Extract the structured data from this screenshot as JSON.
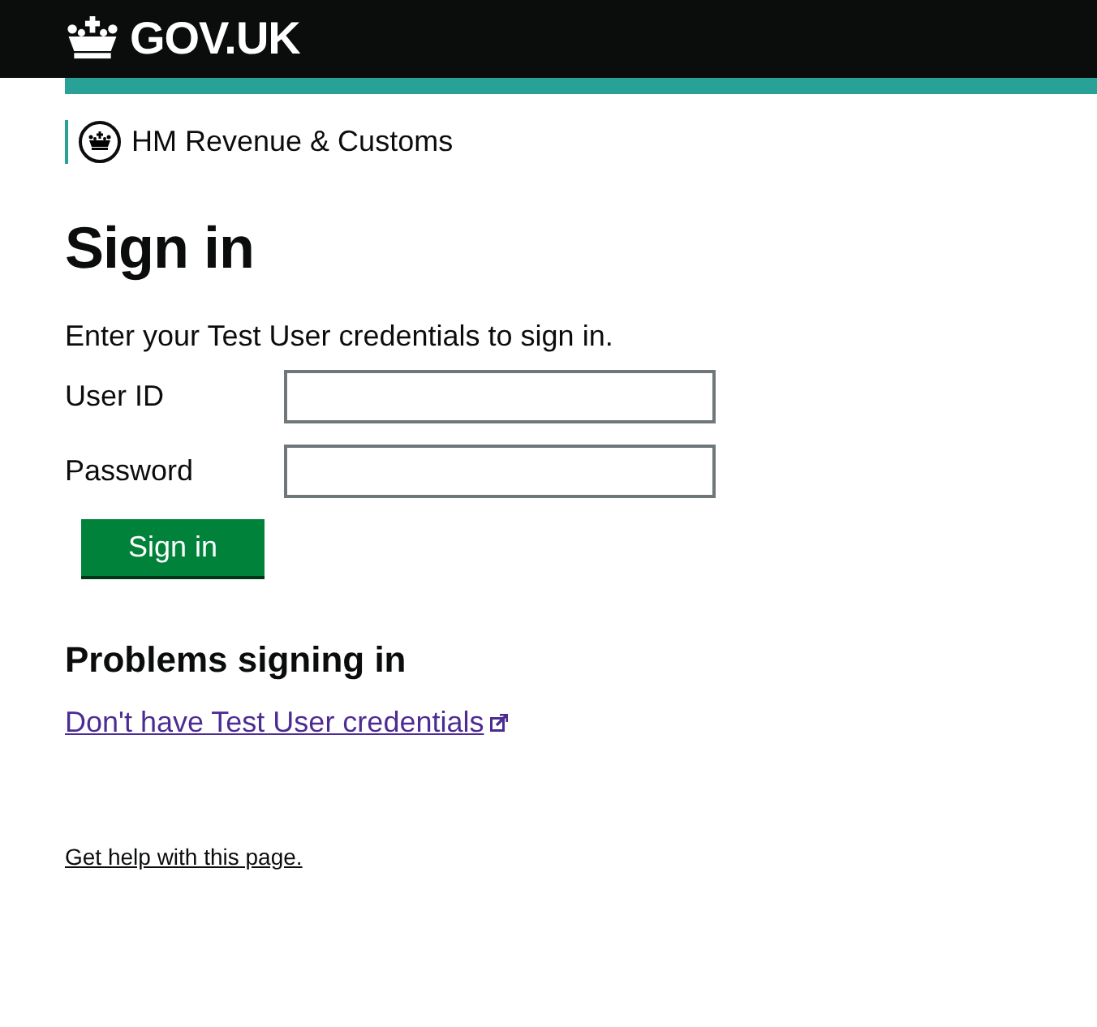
{
  "header": {
    "logo_text": "GOV.UK"
  },
  "department": {
    "name": "HM Revenue & Customs"
  },
  "heading": "Sign in",
  "intro": "Enter your Test User credentials to sign in.",
  "fields": [
    {
      "label": "User ID"
    },
    {
      "label": "Password"
    }
  ],
  "submit_button": "Sign in",
  "problems": {
    "heading": "Problems signing in",
    "link": "Don't have Test User credentials"
  },
  "footer_link": "Get help with this page."
}
